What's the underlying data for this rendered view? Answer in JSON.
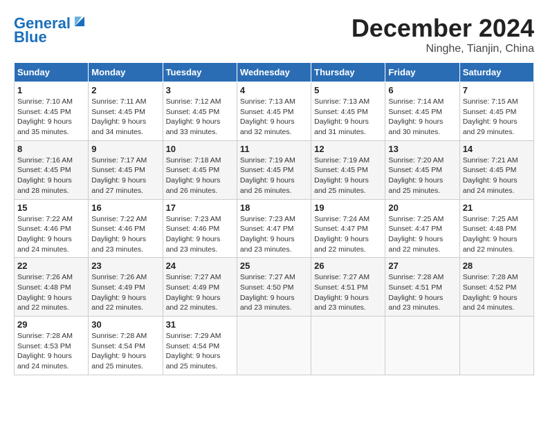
{
  "header": {
    "logo_general": "General",
    "logo_blue": "Blue",
    "title": "December 2024",
    "subtitle": "Ninghe, Tianjin, China"
  },
  "calendar": {
    "days_of_week": [
      "Sunday",
      "Monday",
      "Tuesday",
      "Wednesday",
      "Thursday",
      "Friday",
      "Saturday"
    ],
    "weeks": [
      [
        {
          "day": "1",
          "sunrise": "7:10 AM",
          "sunset": "4:45 PM",
          "daylight": "9 hours and 35 minutes."
        },
        {
          "day": "2",
          "sunrise": "7:11 AM",
          "sunset": "4:45 PM",
          "daylight": "9 hours and 34 minutes."
        },
        {
          "day": "3",
          "sunrise": "7:12 AM",
          "sunset": "4:45 PM",
          "daylight": "9 hours and 33 minutes."
        },
        {
          "day": "4",
          "sunrise": "7:13 AM",
          "sunset": "4:45 PM",
          "daylight": "9 hours and 32 minutes."
        },
        {
          "day": "5",
          "sunrise": "7:13 AM",
          "sunset": "4:45 PM",
          "daylight": "9 hours and 31 minutes."
        },
        {
          "day": "6",
          "sunrise": "7:14 AM",
          "sunset": "4:45 PM",
          "daylight": "9 hours and 30 minutes."
        },
        {
          "day": "7",
          "sunrise": "7:15 AM",
          "sunset": "4:45 PM",
          "daylight": "9 hours and 29 minutes."
        }
      ],
      [
        {
          "day": "8",
          "sunrise": "7:16 AM",
          "sunset": "4:45 PM",
          "daylight": "9 hours and 28 minutes."
        },
        {
          "day": "9",
          "sunrise": "7:17 AM",
          "sunset": "4:45 PM",
          "daylight": "9 hours and 27 minutes."
        },
        {
          "day": "10",
          "sunrise": "7:18 AM",
          "sunset": "4:45 PM",
          "daylight": "9 hours and 26 minutes."
        },
        {
          "day": "11",
          "sunrise": "7:19 AM",
          "sunset": "4:45 PM",
          "daylight": "9 hours and 26 minutes."
        },
        {
          "day": "12",
          "sunrise": "7:19 AM",
          "sunset": "4:45 PM",
          "daylight": "9 hours and 25 minutes."
        },
        {
          "day": "13",
          "sunrise": "7:20 AM",
          "sunset": "4:45 PM",
          "daylight": "9 hours and 25 minutes."
        },
        {
          "day": "14",
          "sunrise": "7:21 AM",
          "sunset": "4:45 PM",
          "daylight": "9 hours and 24 minutes."
        }
      ],
      [
        {
          "day": "15",
          "sunrise": "7:22 AM",
          "sunset": "4:46 PM",
          "daylight": "9 hours and 24 minutes."
        },
        {
          "day": "16",
          "sunrise": "7:22 AM",
          "sunset": "4:46 PM",
          "daylight": "9 hours and 23 minutes."
        },
        {
          "day": "17",
          "sunrise": "7:23 AM",
          "sunset": "4:46 PM",
          "daylight": "9 hours and 23 minutes."
        },
        {
          "day": "18",
          "sunrise": "7:23 AM",
          "sunset": "4:47 PM",
          "daylight": "9 hours and 23 minutes."
        },
        {
          "day": "19",
          "sunrise": "7:24 AM",
          "sunset": "4:47 PM",
          "daylight": "9 hours and 22 minutes."
        },
        {
          "day": "20",
          "sunrise": "7:25 AM",
          "sunset": "4:47 PM",
          "daylight": "9 hours and 22 minutes."
        },
        {
          "day": "21",
          "sunrise": "7:25 AM",
          "sunset": "4:48 PM",
          "daylight": "9 hours and 22 minutes."
        }
      ],
      [
        {
          "day": "22",
          "sunrise": "7:26 AM",
          "sunset": "4:48 PM",
          "daylight": "9 hours and 22 minutes."
        },
        {
          "day": "23",
          "sunrise": "7:26 AM",
          "sunset": "4:49 PM",
          "daylight": "9 hours and 22 minutes."
        },
        {
          "day": "24",
          "sunrise": "7:27 AM",
          "sunset": "4:49 PM",
          "daylight": "9 hours and 22 minutes."
        },
        {
          "day": "25",
          "sunrise": "7:27 AM",
          "sunset": "4:50 PM",
          "daylight": "9 hours and 23 minutes."
        },
        {
          "day": "26",
          "sunrise": "7:27 AM",
          "sunset": "4:51 PM",
          "daylight": "9 hours and 23 minutes."
        },
        {
          "day": "27",
          "sunrise": "7:28 AM",
          "sunset": "4:51 PM",
          "daylight": "9 hours and 23 minutes."
        },
        {
          "day": "28",
          "sunrise": "7:28 AM",
          "sunset": "4:52 PM",
          "daylight": "9 hours and 24 minutes."
        }
      ],
      [
        {
          "day": "29",
          "sunrise": "7:28 AM",
          "sunset": "4:53 PM",
          "daylight": "9 hours and 24 minutes."
        },
        {
          "day": "30",
          "sunrise": "7:28 AM",
          "sunset": "4:54 PM",
          "daylight": "9 hours and 25 minutes."
        },
        {
          "day": "31",
          "sunrise": "7:29 AM",
          "sunset": "4:54 PM",
          "daylight": "9 hours and 25 minutes."
        },
        null,
        null,
        null,
        null
      ]
    ]
  }
}
